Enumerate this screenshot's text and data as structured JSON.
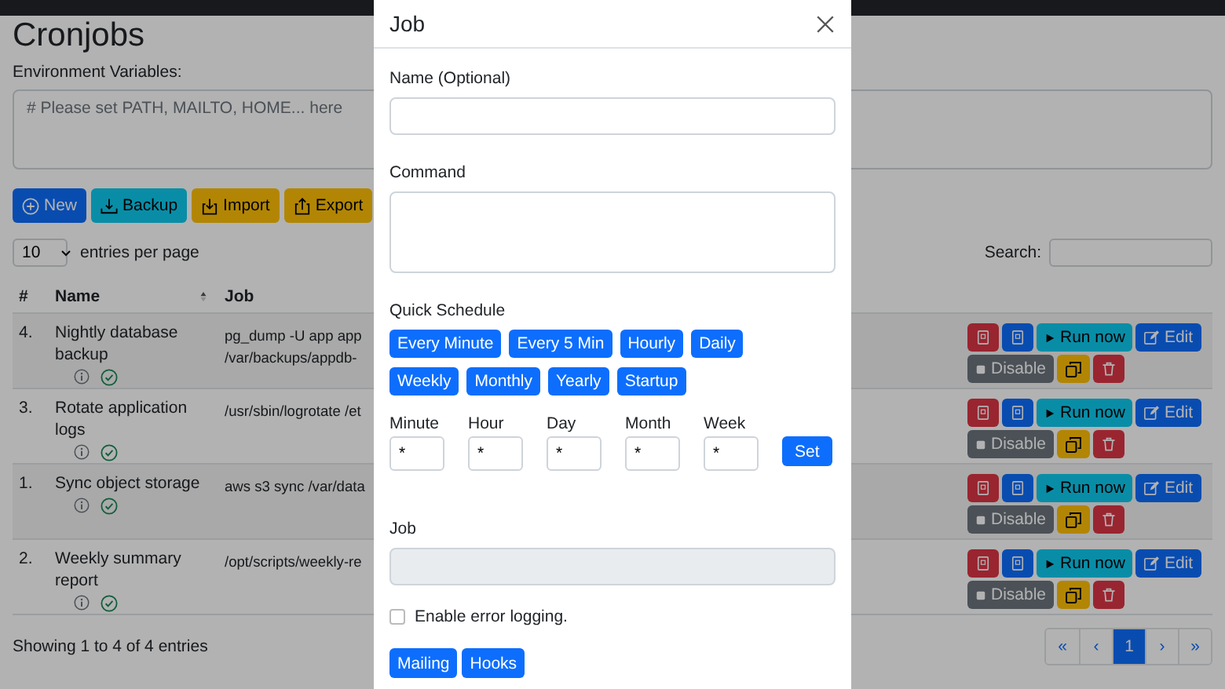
{
  "page": {
    "title": "Cronjobs",
    "env_label": "Environment Variables:",
    "env_placeholder": "# Please set PATH, MAILTO, HOME... here",
    "toolbar": [
      {
        "label": "New",
        "kind": "new"
      },
      {
        "label": "Backup",
        "kind": "backup"
      },
      {
        "label": "Import",
        "kind": "import"
      },
      {
        "label": "Export",
        "kind": "export"
      }
    ],
    "page_size": "10",
    "entries_label": "entries per page",
    "search_label": "Search:",
    "table": {
      "columns": [
        "#",
        "Name",
        "Job"
      ],
      "rows": [
        {
          "index": "4.",
          "name": "Nightly database backup",
          "job": [
            "pg_dump -U app app",
            "/var/backups/appdb-"
          ],
          "run": "Run now",
          "edit": "Edit",
          "disable": "Disable"
        },
        {
          "index": "3.",
          "name": "Rotate application logs",
          "job": [
            "/usr/sbin/logrotate /et"
          ],
          "run": "Run now",
          "edit": "Edit",
          "disable": "Disable"
        },
        {
          "index": "1.",
          "name": "Sync object storage",
          "job": [
            "aws s3 sync /var/data"
          ],
          "run": "Run now",
          "edit": "Edit",
          "disable": "Disable"
        },
        {
          "index": "2.",
          "name": "Weekly summary report",
          "job": [
            "/opt/scripts/weekly-re"
          ],
          "run": "Run now",
          "edit": "Edit",
          "disable": "Disable"
        }
      ]
    },
    "info": "Showing 1 to 4 of 4 entries",
    "pagination": [
      {
        "label": "«",
        "selected": false
      },
      {
        "label": "‹",
        "selected": false
      },
      {
        "label": "1",
        "selected": true
      },
      {
        "label": "›",
        "selected": false
      },
      {
        "label": "»",
        "selected": false
      }
    ]
  },
  "modal": {
    "title": "Job",
    "name_label": "Name (Optional)",
    "command_label": "Command",
    "quick_label": "Quick Schedule",
    "presets": [
      "Every Minute",
      "Every 5 Min",
      "Hourly",
      "Daily",
      "Weekly",
      "Monthly",
      "Yearly",
      "Startup"
    ],
    "cron_fields": [
      {
        "label": "Minute",
        "value": "*"
      },
      {
        "label": "Hour",
        "value": "*"
      },
      {
        "label": "Day",
        "value": "*"
      },
      {
        "label": "Month",
        "value": "*"
      },
      {
        "label": "Week",
        "value": "*"
      }
    ],
    "set_button": "Set",
    "job_label": "Job",
    "job_field": {
      "disabled": true
    },
    "error_logging": {
      "label": "Enable error logging.",
      "checked": false
    },
    "footer_buttons": [
      "Mailing",
      "Hooks"
    ]
  }
}
